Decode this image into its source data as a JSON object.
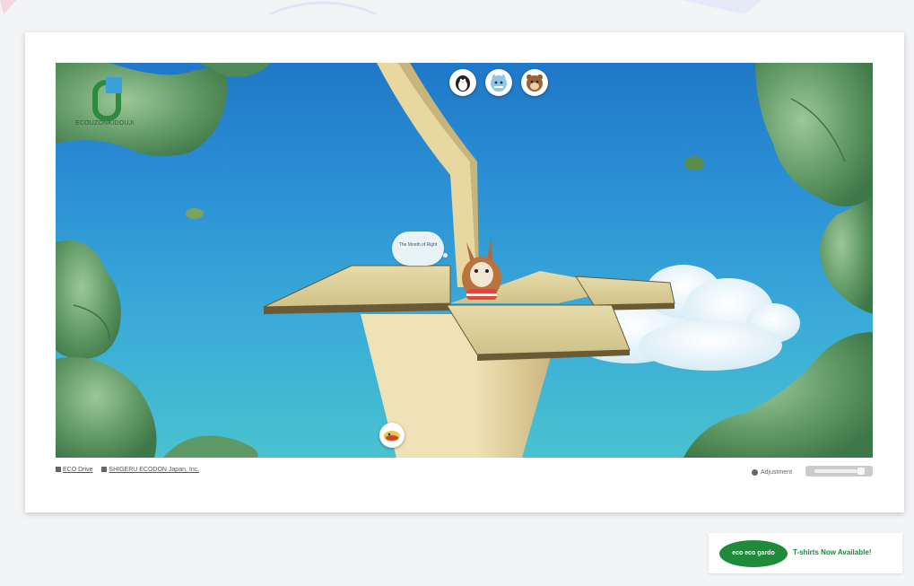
{
  "scene": {
    "logo_text": "ECOUZONKIDOUJI",
    "thought_text": "The Month of Right",
    "character_buttons": [
      {
        "name": "character-button-1",
        "icon": "penguin-icon"
      },
      {
        "name": "character-button-2",
        "icon": "cat-icon"
      },
      {
        "name": "character-button-3",
        "icon": "bear-icon"
      }
    ],
    "bottom_button_icon": "bird-icon"
  },
  "footer": {
    "links": [
      "ECO Drive",
      "SHIGERU ECODON Japan, Inc."
    ],
    "settings_label": "Adjustment"
  },
  "promo": {
    "badge_text": "eco eco gardo",
    "label": "T-shirts Now Available!"
  },
  "colors": {
    "sky_top": "#1f78c8",
    "sky_bottom": "#49c2cf",
    "leaf": "#6aa06e",
    "cardboard": "#d8c48a",
    "promo_green": "#1f8a3a"
  }
}
